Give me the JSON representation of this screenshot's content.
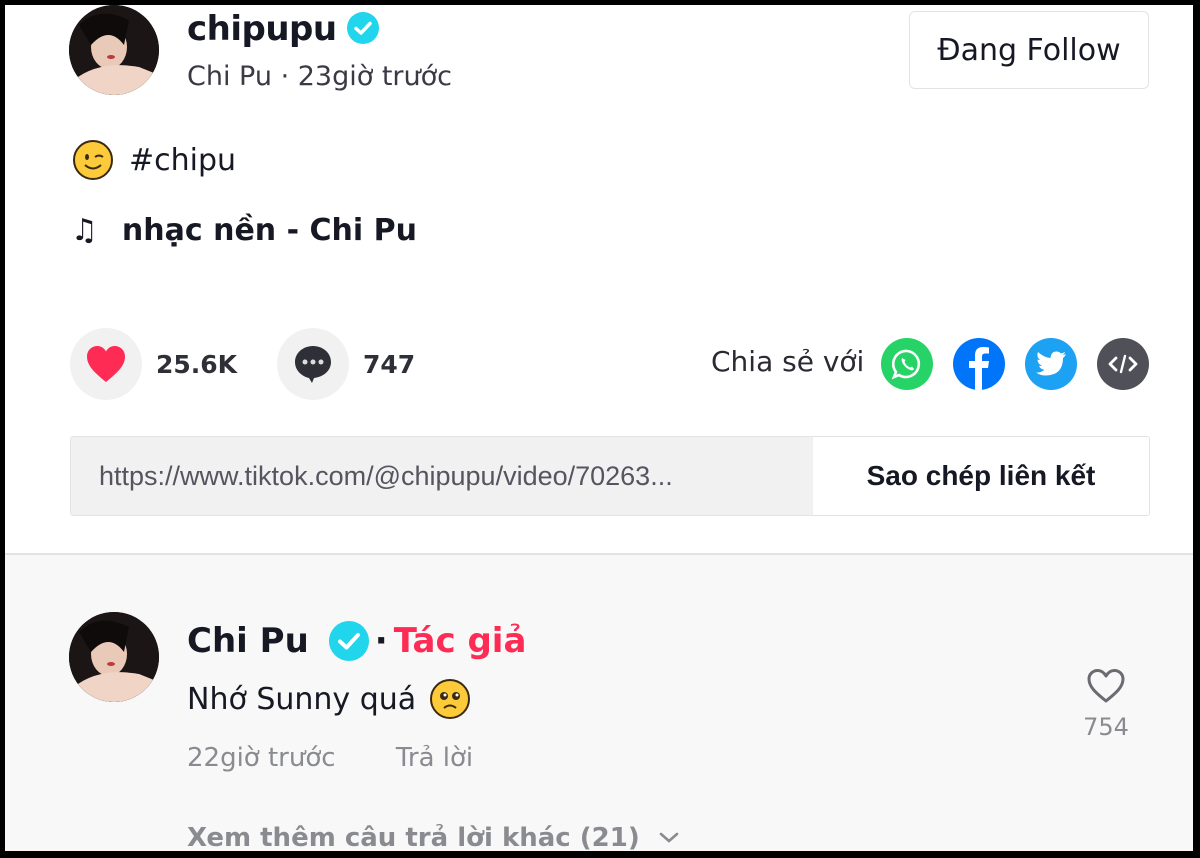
{
  "post": {
    "username": "chipupu",
    "display_name": "Chi Pu",
    "separator": "·",
    "time_ago": "23giờ trước",
    "follow_button": "Đang Follow",
    "caption_hashtag": "#chipu",
    "music_note": "♫",
    "music": "nhạc nền - Chi Pu",
    "likes": "25.6K",
    "comments": "747",
    "share_label": "Chia sẻ với",
    "share_targets": [
      "whatsapp",
      "facebook",
      "twitter",
      "embed"
    ],
    "link_url": "https://www.tiktok.com/@chipupu/video/70263...",
    "copy_link_button": "Sao chép liên kết"
  },
  "comment": {
    "author": "Chi Pu",
    "separator": "·",
    "author_badge": "Tác giả",
    "text": "Nhớ Sunny quá",
    "time_ago": "22giờ trước",
    "reply_button": "Trả lời",
    "like_count": "754",
    "view_more_replies": "Xem thêm câu trả lời khác (21)"
  },
  "colors": {
    "verified": "#20d5ec",
    "like_red": "#fe2c55",
    "whatsapp": "#25d366",
    "facebook": "#0075fa",
    "twitter": "#1da1f2",
    "embed": "#505158"
  }
}
